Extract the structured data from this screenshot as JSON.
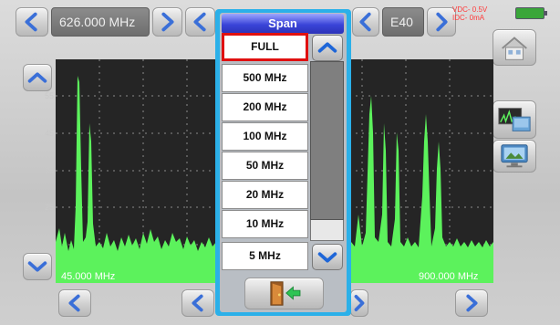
{
  "top_bar": {
    "frequency": "626.000 MHz",
    "channel": "E40",
    "vdc": "VDC- 0.5V",
    "idc": "IDC-  0mA"
  },
  "spectrum": {
    "y_ticks": [
      "55",
      "45",
      "35",
      "25",
      "15"
    ],
    "start_freq": "45.000 MHz",
    "stop_freq": "900.000 MHz"
  },
  "span_popup": {
    "title": "Span",
    "options": [
      "FULL",
      "500 MHz",
      "200 MHz",
      "100 MHz",
      "50 MHz",
      "20 MHz",
      "10 MHz",
      "5 MHz"
    ],
    "selected": "FULL"
  },
  "icons": {
    "home": "home-icon",
    "screen1": "spectrum-view-icon",
    "screen2": "monitor-icon",
    "exit": "exit-door-icon",
    "battery": "battery-icon"
  },
  "colors": {
    "spectrum_trace": "#5cf25c",
    "popup_border": "#2bb0e9",
    "popup_title": "#3a44d8",
    "selected_outline": "#e01010",
    "arrow_blue": "#3a6fd8",
    "warning_red": "#ff3a3a"
  }
}
